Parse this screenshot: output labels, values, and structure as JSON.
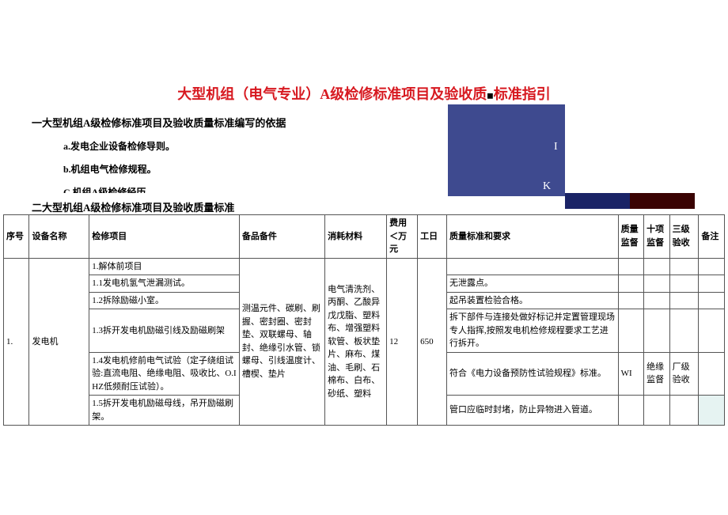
{
  "title_part1": "大型机组（电气专业）A级检修标准项目及验收质",
  "title_part2": "标准指引",
  "section1_heading": "一大型机组A级检修标准项目及验收质量标准编写的依据",
  "bullets": {
    "a": "a.发电企业设备检修导则。",
    "b": "b.机组电气检修规程。",
    "c": "C 机组A级检修经历"
  },
  "deco": {
    "i": "I",
    "k": "K"
  },
  "section2_heading": "二大型机组A级检修标准项目及验收质量标准",
  "headers": {
    "idx": "序号",
    "eq": "设备名称",
    "item": "检修项目",
    "spare": "备品备件",
    "mat": "消耗材料",
    "cost": "费用＜万元",
    "day": "工日",
    "req": "质量标准和要求",
    "q1": "质量监督",
    "q2": "十项监督",
    "q3": "三级验收",
    "note": "备注"
  },
  "body": {
    "idx": "1.",
    "eq": "发电机",
    "spare": "测温元件、碳刷、刷握、密封圈、密封垫、双联螺母、轴封、绝缘引水管、锁螺母、引线温度计、槽楔、垫片",
    "mat": "电气清洗剂、丙酮、乙酸异戊戊脂、塑料布、增强塑料软管、板状垫片、麻布、煤油、毛刷、石棉布、白布、砂纸、塑料",
    "cost": "12",
    "day": "650",
    "row1_item": "1.解体前项目",
    "row2_item": "1.1发电机氢气泄漏测试。",
    "row2_req": "无泄露点。",
    "row3_item": "1.2拆除励磁小室。",
    "row3_req": "起吊装置检验合格。",
    "row4_item": "1.3拆开发电机励磁引线及励磁刷架",
    "row4_req": "拆下部件与连接处做好标记并定置管理现场专人指挥,按照发电机检修规程要求工艺进行拆开。",
    "row5_item": "1.4发电机修前电气试验（定子绕组试验:直流电阻、绝缘电阻、吸收比、O.IHZ低频耐压试验）。",
    "row5_req": "符合《电力设备预防性试验规程》标准。",
    "row5_q1": "WI",
    "row5_q2": "绝缘监督",
    "row5_q3": "厂级验收",
    "row6_item": "1.5拆开发电机励磁母线，吊开励磁刷架。",
    "row6_req": "管口应临时封堵，防止异物进入管道。"
  }
}
